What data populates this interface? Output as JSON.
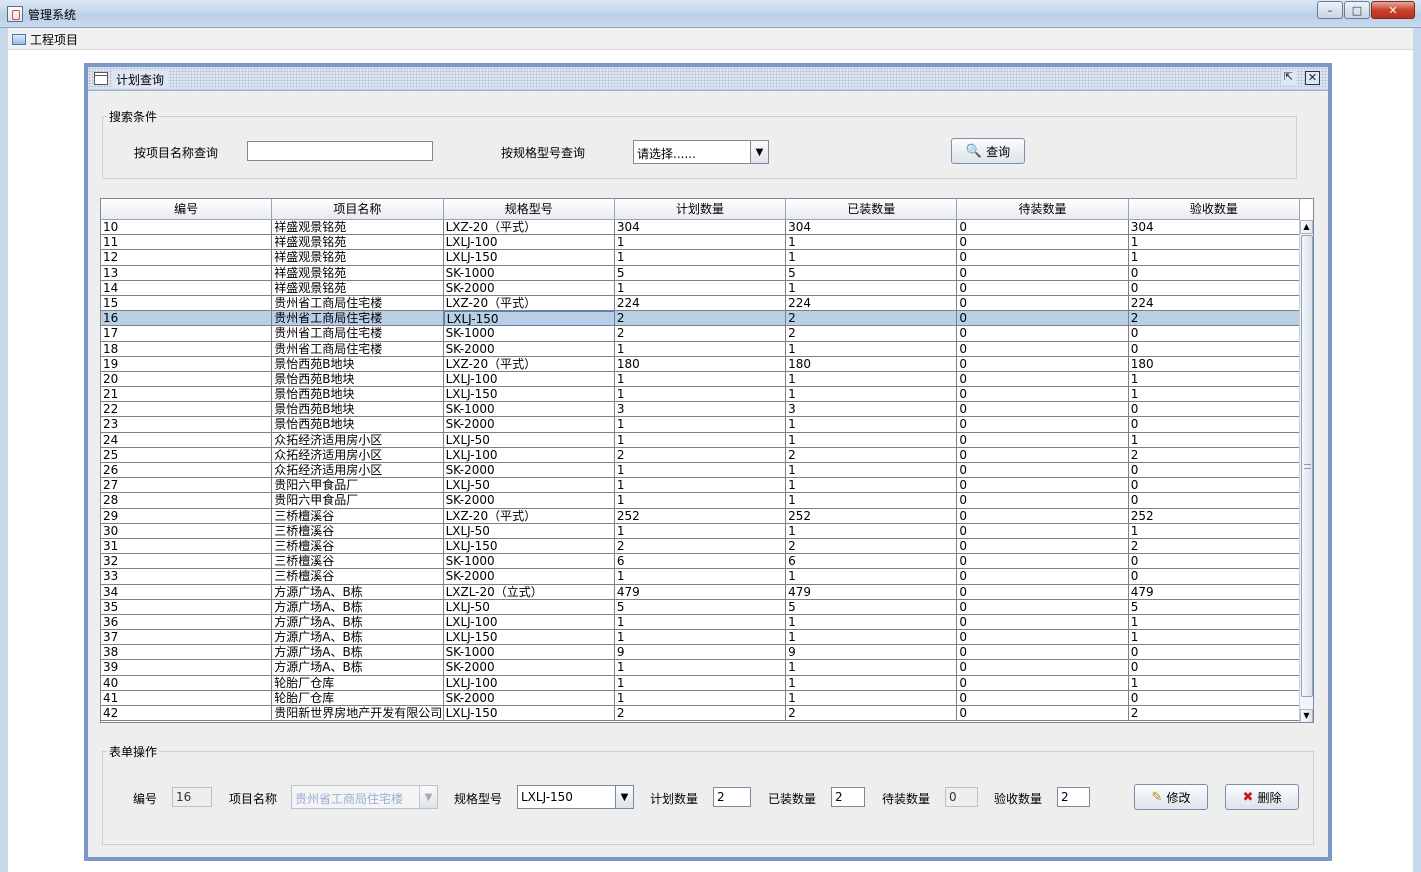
{
  "window": {
    "title": "管理系统"
  },
  "menubar": {
    "items": [
      {
        "label": "工程项目"
      }
    ]
  },
  "frame": {
    "title": "计划查询",
    "search": {
      "legend": "搜索条件",
      "name_label": "按项目名称查询",
      "name_value": "",
      "spec_label": "按规格型号查询",
      "spec_value": "请选择......",
      "query_button": "查询"
    },
    "table": {
      "columns": [
        "编号",
        "项目名称",
        "规格型号",
        "计划数量",
        "已装数量",
        "待装数量",
        "验收数量"
      ],
      "selected_row": 6,
      "rows": [
        [
          "10",
          "祥盛观景铭苑",
          "LXZ-20（平式）",
          "304",
          "304",
          "0",
          "304"
        ],
        [
          "11",
          "祥盛观景铭苑",
          "LXLJ-100",
          "1",
          "1",
          "0",
          "1"
        ],
        [
          "12",
          "祥盛观景铭苑",
          "LXLJ-150",
          "1",
          "1",
          "0",
          "1"
        ],
        [
          "13",
          "祥盛观景铭苑",
          "SK-1000",
          "5",
          "5",
          "0",
          "0"
        ],
        [
          "14",
          "祥盛观景铭苑",
          "SK-2000",
          "1",
          "1",
          "0",
          "0"
        ],
        [
          "15",
          "贵州省工商局住宅楼",
          "LXZ-20（平式）",
          "224",
          "224",
          "0",
          "224"
        ],
        [
          "16",
          "贵州省工商局住宅楼",
          "LXLJ-150",
          "2",
          "2",
          "0",
          "2"
        ],
        [
          "17",
          "贵州省工商局住宅楼",
          "SK-1000",
          "2",
          "2",
          "0",
          "0"
        ],
        [
          "18",
          "贵州省工商局住宅楼",
          "SK-2000",
          "1",
          "1",
          "0",
          "0"
        ],
        [
          "19",
          "景怡西苑B地块",
          "LXZ-20（平式）",
          "180",
          "180",
          "0",
          "180"
        ],
        [
          "20",
          "景怡西苑B地块",
          "LXLJ-100",
          "1",
          "1",
          "0",
          "1"
        ],
        [
          "21",
          "景怡西苑B地块",
          "LXLJ-150",
          "1",
          "1",
          "0",
          "1"
        ],
        [
          "22",
          "景怡西苑B地块",
          "SK-1000",
          "3",
          "3",
          "0",
          "0"
        ],
        [
          "23",
          "景怡西苑B地块",
          "SK-2000",
          "1",
          "1",
          "0",
          "0"
        ],
        [
          "24",
          "众拓经济适用房小区",
          "LXLJ-50",
          "1",
          "1",
          "0",
          "1"
        ],
        [
          "25",
          "众拓经济适用房小区",
          "LXLJ-100",
          "2",
          "2",
          "0",
          "2"
        ],
        [
          "26",
          "众拓经济适用房小区",
          "SK-2000",
          "1",
          "1",
          "0",
          "0"
        ],
        [
          "27",
          "贵阳六甲食品厂",
          "LXLJ-50",
          "1",
          "1",
          "0",
          "0"
        ],
        [
          "28",
          "贵阳六甲食品厂",
          "SK-2000",
          "1",
          "1",
          "0",
          "0"
        ],
        [
          "29",
          "三桥檀溪谷",
          "LXZ-20（平式）",
          "252",
          "252",
          "0",
          "252"
        ],
        [
          "30",
          "三桥檀溪谷",
          "LXLJ-50",
          "1",
          "1",
          "0",
          "1"
        ],
        [
          "31",
          "三桥檀溪谷",
          "LXLJ-150",
          "2",
          "2",
          "0",
          "2"
        ],
        [
          "32",
          "三桥檀溪谷",
          "SK-1000",
          "6",
          "6",
          "0",
          "0"
        ],
        [
          "33",
          "三桥檀溪谷",
          "SK-2000",
          "1",
          "1",
          "0",
          "0"
        ],
        [
          "34",
          "方源广场A、B栋",
          "LXZL-20（立式）",
          "479",
          "479",
          "0",
          "479"
        ],
        [
          "35",
          "方源广场A、B栋",
          "LXLJ-50",
          "5",
          "5",
          "0",
          "5"
        ],
        [
          "36",
          "方源广场A、B栋",
          "LXLJ-100",
          "1",
          "1",
          "0",
          "1"
        ],
        [
          "37",
          "方源广场A、B栋",
          "LXLJ-150",
          "1",
          "1",
          "0",
          "1"
        ],
        [
          "38",
          "方源广场A、B栋",
          "SK-1000",
          "9",
          "9",
          "0",
          "0"
        ],
        [
          "39",
          "方源广场A、B栋",
          "SK-2000",
          "1",
          "1",
          "0",
          "0"
        ],
        [
          "40",
          "轮胎厂仓库",
          "LXLJ-100",
          "1",
          "1",
          "0",
          "1"
        ],
        [
          "41",
          "轮胎厂仓库",
          "SK-2000",
          "1",
          "1",
          "0",
          "0"
        ],
        [
          "42",
          "贵阳新世界房地产开发有限公司",
          "LXLJ-150",
          "2",
          "2",
          "0",
          "2"
        ]
      ]
    },
    "form": {
      "legend": "表单操作",
      "id_label": "编号",
      "id_value": "16",
      "name_label": "项目名称",
      "name_value": "贵州省工商局住宅楼",
      "spec_label": "规格型号",
      "spec_value": "LXLJ-150",
      "plan_label": "计划数量",
      "plan_value": "2",
      "installed_label": "已装数量",
      "installed_value": "2",
      "pending_label": "待装数量",
      "pending_value": "0",
      "accept_label": "验收数量",
      "accept_value": "2",
      "edit_button": "修改",
      "delete_button": "删除"
    }
  }
}
